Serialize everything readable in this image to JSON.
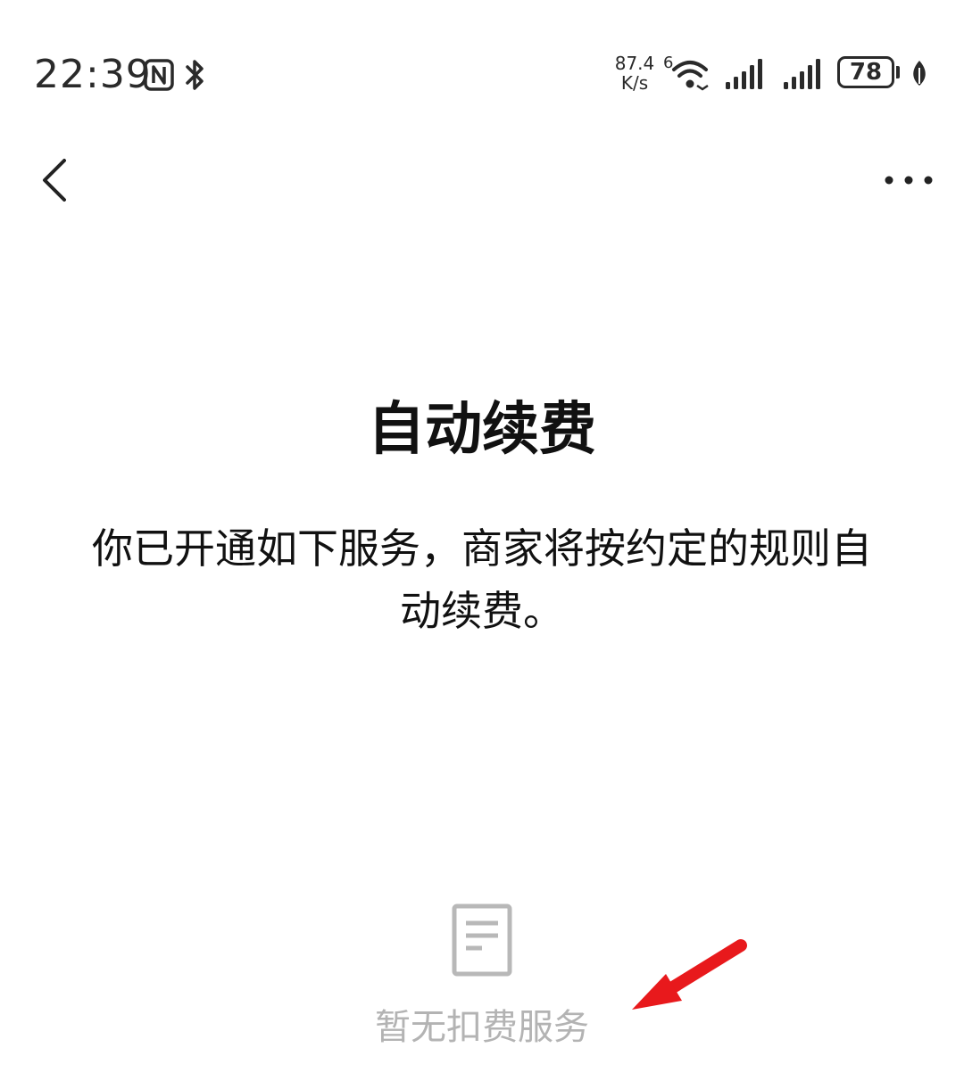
{
  "status_bar": {
    "time": "22:39",
    "net_speed_value": "87.4",
    "net_speed_unit": "K/s",
    "wifi_badge": "6",
    "battery_level": "78",
    "icons": [
      "nfc-icon",
      "bluetooth-icon",
      "wifi-6-icon",
      "signal-icon",
      "signal-icon",
      "battery-icon",
      "leaf-icon"
    ]
  },
  "nav": {
    "back_icon": "chevron-left-icon",
    "more_icon": "more-horizontal-icon"
  },
  "main": {
    "title": "自动续费",
    "description": "你已开通如下服务，商家将按约定的规则自动续费。"
  },
  "empty_state": {
    "icon": "document-icon",
    "text": "暂无扣费服务"
  },
  "annotation": {
    "icon": "red-arrow-icon",
    "color": "#e8191c"
  },
  "colors": {
    "background": "#ffffff",
    "text_primary": "#111111",
    "text_muted": "#b3b3b3",
    "annotation_red": "#e8191c"
  }
}
